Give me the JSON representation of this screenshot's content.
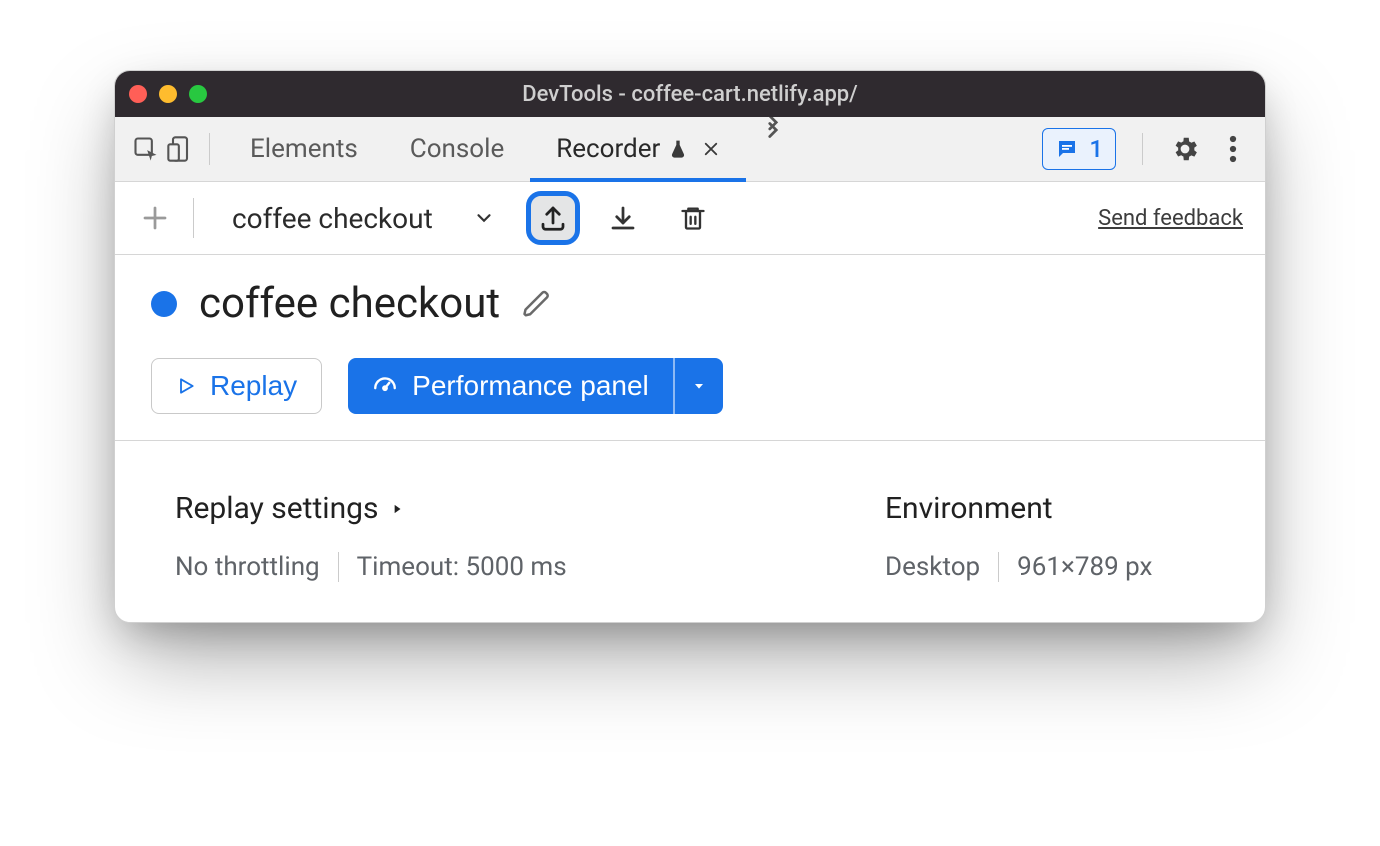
{
  "window": {
    "title": "DevTools - coffee-cart.netlify.app/"
  },
  "tabs": {
    "elements": "Elements",
    "console": "Console",
    "recorder": "Recorder"
  },
  "issues": {
    "count": "1"
  },
  "toolbar": {
    "recording_name": "coffee checkout",
    "feedback": "Send feedback"
  },
  "recording": {
    "title": "coffee checkout",
    "replay_label": "Replay",
    "perf_label": "Performance panel"
  },
  "settings": {
    "replay_heading": "Replay settings",
    "throttling": "No throttling",
    "timeout": "Timeout: 5000 ms",
    "env_heading": "Environment",
    "device": "Desktop",
    "viewport": "961×789 px"
  }
}
